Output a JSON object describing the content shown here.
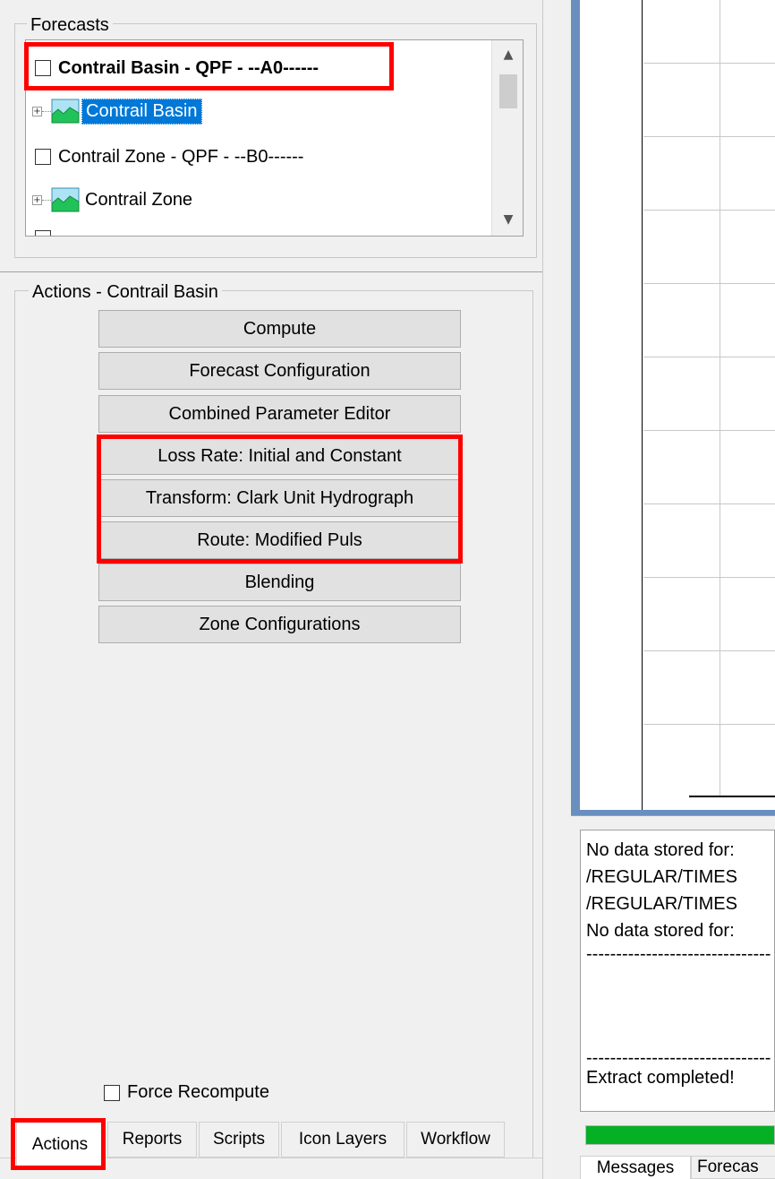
{
  "forecasts": {
    "title": "Forecasts",
    "items": [
      {
        "label": "Contrail Basin - QPF - --A0------",
        "type": "forecast",
        "checked": false,
        "bold": true
      },
      {
        "label": "Contrail Basin",
        "type": "basin",
        "selected": true
      },
      {
        "label": "Contrail Zone - QPF - --B0------",
        "type": "forecast",
        "checked": false
      },
      {
        "label": "Contrail Zone",
        "type": "basin",
        "selected": false
      }
    ]
  },
  "actions": {
    "title": "Actions - Contrail Basin",
    "buttons": [
      "Compute",
      "Forecast Configuration",
      "Combined Parameter Editor",
      "Loss Rate: Initial and Constant",
      "Transform: Clark Unit Hydrograph",
      "Route: Modified Puls",
      "Blending",
      "Zone Configurations"
    ],
    "force_recompute": {
      "label": "Force Recompute",
      "checked": false
    }
  },
  "left_tabs": [
    "Actions",
    "Reports",
    "Scripts",
    "Icon Layers",
    "Workflow"
  ],
  "messages": {
    "lines": [
      "No data stored for:",
      "/REGULAR/TIMES",
      "/REGULAR/TIMES",
      "No data stored for:",
      "-------------------------------",
      "",
      "",
      "-------------------------------",
      "Extract completed!"
    ],
    "progress_percent": 100,
    "progress_color": "#06b025"
  },
  "right_tabs": [
    "Messages",
    "Forecas"
  ],
  "colors": {
    "highlight": "#ff0000",
    "selection": "#0078d7",
    "plot_frame": "#6a8fbf"
  }
}
